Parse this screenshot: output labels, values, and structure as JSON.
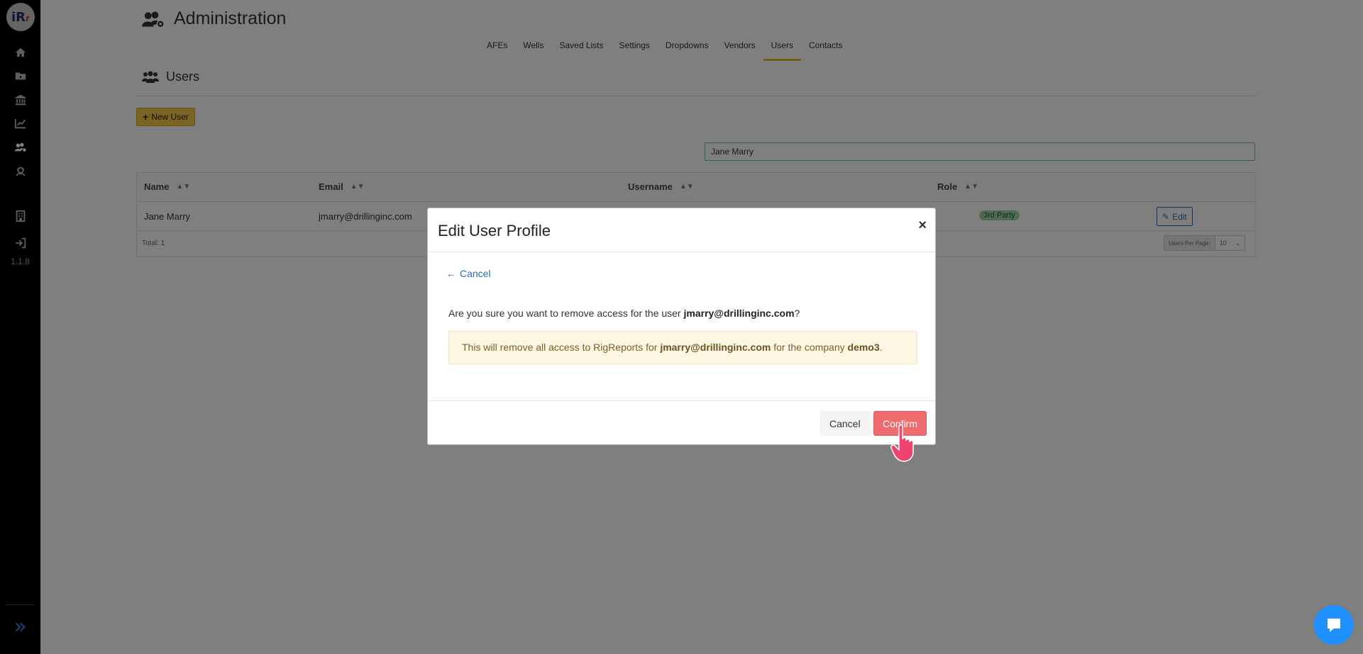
{
  "sidebar": {
    "logo_text": "iR",
    "logo_suffix": "r",
    "version": "1.1.8",
    "icons": [
      "home-icon",
      "folder-icon",
      "bank-icon",
      "chart-line-icon",
      "users-cog-icon",
      "user-headset-icon",
      "building-icon",
      "sign-in-icon"
    ],
    "expand_icon": "double-chevron-right-icon"
  },
  "header": {
    "title": "Administration"
  },
  "tabs": [
    {
      "label": "AFEs"
    },
    {
      "label": "Wells"
    },
    {
      "label": "Saved Lists"
    },
    {
      "label": "Settings"
    },
    {
      "label": "Dropdowns"
    },
    {
      "label": "Vendors"
    },
    {
      "label": "Users",
      "active": true
    },
    {
      "label": "Contacts"
    }
  ],
  "section": {
    "title": "Users"
  },
  "toolbar": {
    "new_user_label": "New User"
  },
  "search": {
    "value": "Jane Marry"
  },
  "table": {
    "columns": [
      "Name",
      "Email",
      "Username",
      "Role"
    ],
    "rows": [
      {
        "name": "Jane Marry",
        "email": "jmarry@drillinginc.com",
        "username": "",
        "role": "3rd Party",
        "action": "Edit"
      }
    ],
    "total_label": "Total: 1",
    "per_page_label": "Users Per Page:",
    "per_page_value": "10"
  },
  "modal": {
    "title": "Edit User Profile",
    "close": "×",
    "back_label": "Cancel",
    "question_prefix": "Are you sure you want to remove access for the user ",
    "question_email": "jmarry@drillinginc.com",
    "question_suffix": "?",
    "warning_prefix": "This will remove all access to RigReports for ",
    "warning_email": "jmarry@drillinginc.com",
    "warning_mid": " for the company ",
    "warning_company": "demo3",
    "warning_suffix": ".",
    "cancel_label": "Cancel",
    "confirm_label": "Confirm"
  },
  "colors": {
    "sidebar_bg": "#000000",
    "accent_yellow": "#f4c844",
    "confirm_red": "#ee6b6e",
    "link_blue": "#2a6db5",
    "chat_blue": "#1e90ff"
  }
}
